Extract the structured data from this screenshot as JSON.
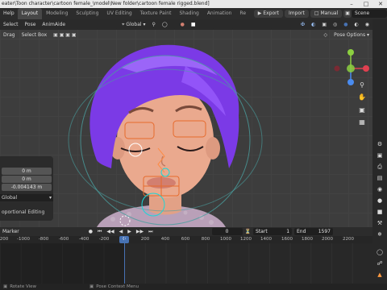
{
  "window": {
    "title": "eater\\Toon character\\cartoon female_\\model\\New folder\\cartoon female rigged.blend]"
  },
  "topbar": {
    "menu": [
      "Help"
    ],
    "workspaces": [
      "Layout",
      "Modeling",
      "Sculpting",
      "UV Editing",
      "Texture Paint",
      "Shading",
      "Animation",
      "Re"
    ],
    "active_workspace": "Layout",
    "buttons": [
      "Export",
      "Import",
      "Manual"
    ],
    "scene_label": "Scene"
  },
  "viewport_header": {
    "menu": [
      "Select",
      "Pose",
      "AnimAide"
    ],
    "orientation": "Global"
  },
  "tool_header": {
    "drag_label": "Drag",
    "select_mode": "Select Box",
    "pose_options": "Pose Options"
  },
  "sidebar_panel": {
    "fields": [
      "0 m",
      "0 m",
      "-0.004143 m"
    ],
    "orientation": "Global",
    "proportional_label": "oportional Editing"
  },
  "timeline": {
    "marker_label": "Marker",
    "current_frame": "0",
    "start_label": "Start",
    "start_value": "1",
    "end_label": "End",
    "end_value": "1597",
    "ruler_ticks": [
      "200",
      "-1000",
      "-800",
      "-600",
      "-400",
      "-200",
      "0",
      "200",
      "400",
      "600",
      "800",
      "1000",
      "1200",
      "1400",
      "1600",
      "1800",
      "2000",
      "2200"
    ],
    "playhead_label": "0"
  },
  "status_bar": {
    "left": "Rotate View",
    "middle": "Pose Context Menu"
  },
  "colors": {
    "accent_blue": "#4772b3",
    "hair": "#8a3ff0",
    "skin": "#e8a58a",
    "axis_x": "#e04050",
    "axis_y": "#8cd040",
    "axis_z": "#4a8cf0"
  }
}
